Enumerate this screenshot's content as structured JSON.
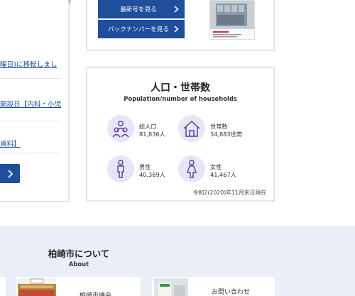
{
  "news": {
    "items": [
      {
        "text": "曜日)に移転しまし"
      },
      {
        "text": "開設日【内科・小児"
      },
      {
        "text": "資料】"
      }
    ]
  },
  "koho": {
    "latest_label": "最新号を見る",
    "backnumber_label": "バックナンバーを見る"
  },
  "population": {
    "title": "人口・世帯数",
    "subtitle": "Population/number of households",
    "stats": [
      {
        "label": "総人口",
        "value": "81,836人",
        "icon": "people-icon"
      },
      {
        "label": "世帯数",
        "value": "34,883世帯",
        "icon": "house-icon"
      },
      {
        "label": "男性",
        "value": "40,369人",
        "icon": "male-icon"
      },
      {
        "label": "女性",
        "value": "41,467人",
        "icon": "female-icon"
      }
    ],
    "as_of": "令和2(2020)年11月末日現在"
  },
  "about": {
    "title": "柏崎市について",
    "subtitle": "About",
    "cards": [
      {
        "label": "柏崎市議会"
      },
      {
        "label": "お問い合わせ"
      }
    ]
  },
  "colors": {
    "brand_blue": "#1f4e9c",
    "panel_border": "#e1e4f1",
    "icon_circle": "#e7e5f7",
    "icon_stroke": "#5a3d8a",
    "about_bg": "#e9eef7"
  }
}
